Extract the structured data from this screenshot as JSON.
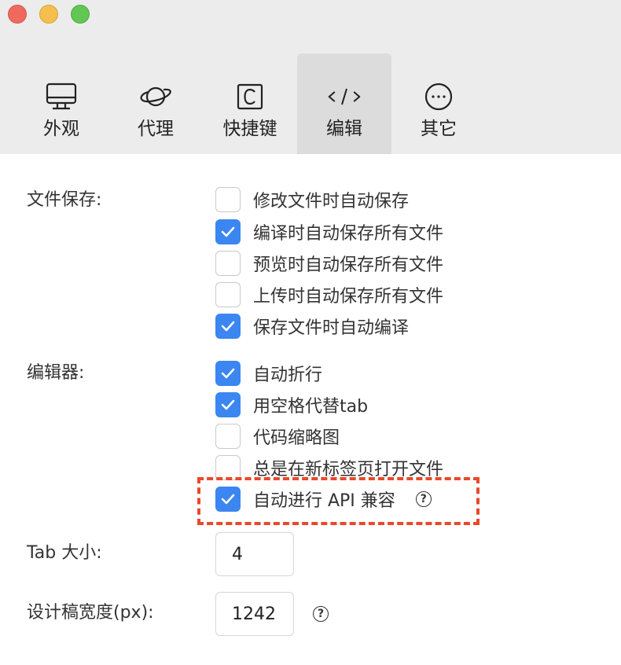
{
  "window": {
    "controls": [
      "close",
      "minimize",
      "maximize"
    ]
  },
  "tabs": [
    {
      "label": "外观",
      "icon": "monitor-icon",
      "active": false
    },
    {
      "label": "代理",
      "icon": "planet-icon",
      "active": false
    },
    {
      "label": "快捷键",
      "icon": "command-key-icon",
      "active": false
    },
    {
      "label": "编辑",
      "icon": "code-icon",
      "active": true
    },
    {
      "label": "其它",
      "icon": "more-icon",
      "active": false
    }
  ],
  "file_save": {
    "label": "文件保存:",
    "options": [
      {
        "label": "修改文件时自动保存",
        "checked": false
      },
      {
        "label": "编译时自动保存所有文件",
        "checked": true
      },
      {
        "label": "预览时自动保存所有文件",
        "checked": false
      },
      {
        "label": "上传时自动保存所有文件",
        "checked": false
      },
      {
        "label": "保存文件时自动编译",
        "checked": true
      }
    ]
  },
  "editor": {
    "label": "编辑器:",
    "options": [
      {
        "label": "自动折行",
        "checked": true
      },
      {
        "label": "用空格代替tab",
        "checked": true
      },
      {
        "label": "代码缩略图",
        "checked": false
      },
      {
        "label": "总是在新标签页打开文件",
        "checked": false
      },
      {
        "label": "自动进行 API 兼容",
        "checked": true,
        "help": "?"
      }
    ]
  },
  "tab_size": {
    "label": "Tab 大小:",
    "value": "4"
  },
  "design_width": {
    "label": "设计稿宽度(px):",
    "value": "1242",
    "help": "?"
  },
  "colors": {
    "accent": "#3b86f0",
    "highlight_dash": "#e7492b"
  }
}
